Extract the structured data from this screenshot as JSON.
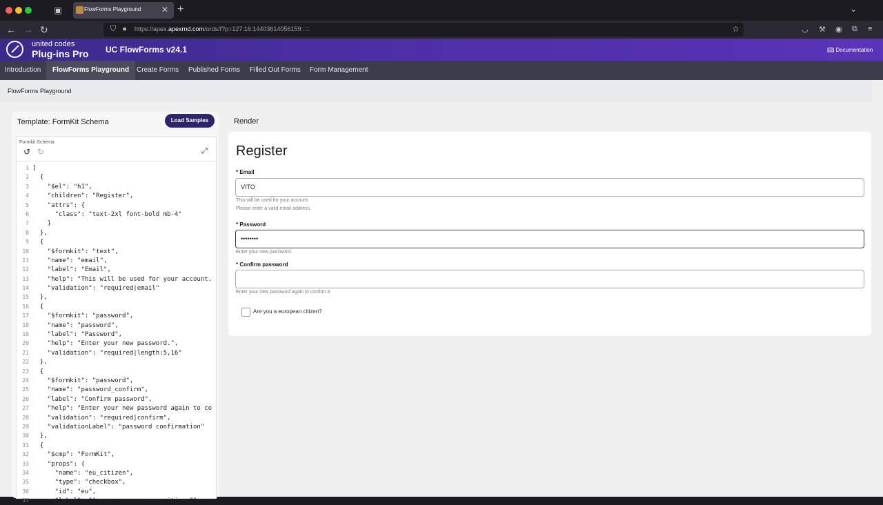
{
  "browser": {
    "tab_title": "FlowForms Playground",
    "url_prefix": "https://apex.",
    "url_domain": "apexrnd.com",
    "url_rest": "/ords/f?p=127:16:14403614056159:::::"
  },
  "app": {
    "brand_line1": "united codes",
    "brand_line2": "Plug-ins Pro",
    "title": "UC FlowForms v24.1",
    "documentation": "Documentation"
  },
  "nav": {
    "items": [
      "Introduction",
      "FlowForms Playground",
      "Create Forms",
      "Published Forms",
      "Filled Out Forms",
      "Form Management"
    ]
  },
  "breadcrumb": "FlowForms Playground",
  "template": {
    "title": "Template: FormKit Schema",
    "load_button": "Load Samples",
    "editor_label": "Formkit Schema",
    "lines": [
      "[",
      "  {",
      "    \"$el\": \"h1\",",
      "    \"children\": \"Register\",",
      "    \"attrs\": {",
      "      \"class\": \"text-2xl font-bold mb-4\"",
      "    }",
      "  },",
      "  {",
      "    \"$formkit\": \"text\",",
      "    \"name\": \"email\",",
      "    \"label\": \"Email\",",
      "    \"help\": \"This will be used for your account.",
      "    \"validation\": \"required|email\"",
      "  },",
      "  {",
      "    \"$formkit\": \"password\",",
      "    \"name\": \"password\",",
      "    \"label\": \"Password\",",
      "    \"help\": \"Enter your new password.\",",
      "    \"validation\": \"required|length:5,16\"",
      "  },",
      "  {",
      "    \"$formkit\": \"password\",",
      "    \"name\": \"password_confirm\",",
      "    \"label\": \"Confirm password\",",
      "    \"help\": \"Enter your new password again to co",
      "    \"validation\": \"required|confirm\",",
      "    \"validationLabel\": \"password confirmation\"",
      "  },",
      "  {",
      "    \"$cmp\": \"FormKit\",",
      "    \"props\": {",
      "      \"name\": \"eu_citizen\",",
      "      \"type\": \"checkbox\",",
      "      \"id\": \"eu\",",
      "      \"label\": \"Are you a european citizen?\""
    ]
  },
  "render": {
    "title": "Render",
    "heading": "Register",
    "email_label": "* Email",
    "email_value": "VITO",
    "email_help": "This will be used for your account.",
    "email_error": "Please enter a valid email address.",
    "password_label": "* Password",
    "password_value": "••••••••",
    "password_help": "Enter your new password.",
    "confirm_label": "* Confirm password",
    "confirm_value": "",
    "confirm_help": "Enter your new password again to confirm it.",
    "checkbox_label": "Are you a european citizen?"
  }
}
